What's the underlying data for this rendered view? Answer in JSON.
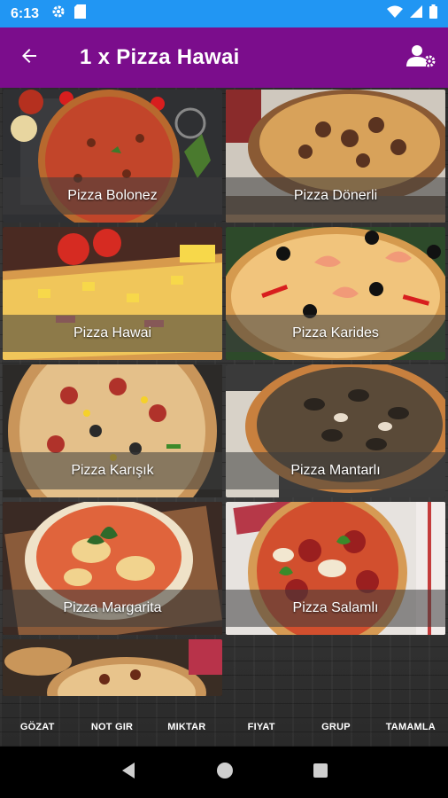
{
  "status_bar": {
    "time": "6:13",
    "icons_left": [
      "settings-icon",
      "sd-card-icon"
    ],
    "icons_right": [
      "wifi-icon",
      "signal-icon",
      "battery-icon"
    ]
  },
  "app_bar": {
    "title": "1 x  Pizza Hawai",
    "back_icon": "arrow-left-icon",
    "user_icon": "user-settings-icon",
    "color": "#7b0d8c"
  },
  "pizzas": [
    {
      "name": "Pizza Bolonez"
    },
    {
      "name": "Pizza Dönerli"
    },
    {
      "name": "Pizza Hawai"
    },
    {
      "name": "Pizza Karides"
    },
    {
      "name": "Pizza Karışık"
    },
    {
      "name": "Pizza Mantarlı"
    },
    {
      "name": "Pizza Margarita"
    },
    {
      "name": "Pizza Salamlı"
    },
    {
      "name": ""
    }
  ],
  "bottom_tabs": [
    "GÖZAT",
    "NOT GIR",
    "MIKTAR",
    "FIYAT",
    "GRUP",
    "TAMAMLA"
  ],
  "nav_bar": {
    "icons": [
      "back-triangle-icon",
      "home-circle-icon",
      "recents-square-icon"
    ]
  }
}
